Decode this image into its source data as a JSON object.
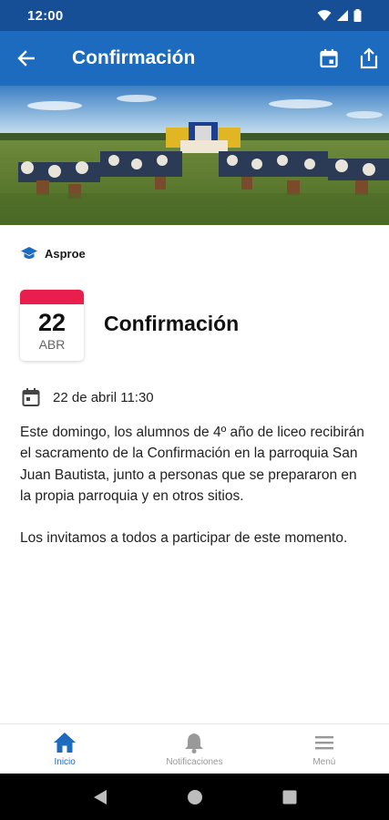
{
  "status_bar": {
    "time": "12:00"
  },
  "app_bar": {
    "title": "Confirmación"
  },
  "organization": {
    "name": "Asproe"
  },
  "event": {
    "day": "22",
    "month": "ABR",
    "title": "Confirmación",
    "datetime": "22 de abril 11:30",
    "description": [
      "Este domingo, los alumnos de 4º año de liceo recibirán el sacramento de la Confirmación en la parroquia San Juan Bautista, junto a personas que se prepararon en la propia parroquia y en otros sitios.",
      "Los invitamos a todos a participar de este momento."
    ]
  },
  "bottom_nav": {
    "items": [
      {
        "label": "Inicio",
        "icon": "home-icon",
        "active": true
      },
      {
        "label": "Notificaciones",
        "icon": "bell-icon",
        "active": false
      },
      {
        "label": "Menú",
        "icon": "menu-icon",
        "active": false
      }
    ]
  },
  "colors": {
    "primary": "#1c6bbf",
    "status_bar": "#174f96",
    "date_accent": "#ea1e4c",
    "inactive": "#999999"
  }
}
